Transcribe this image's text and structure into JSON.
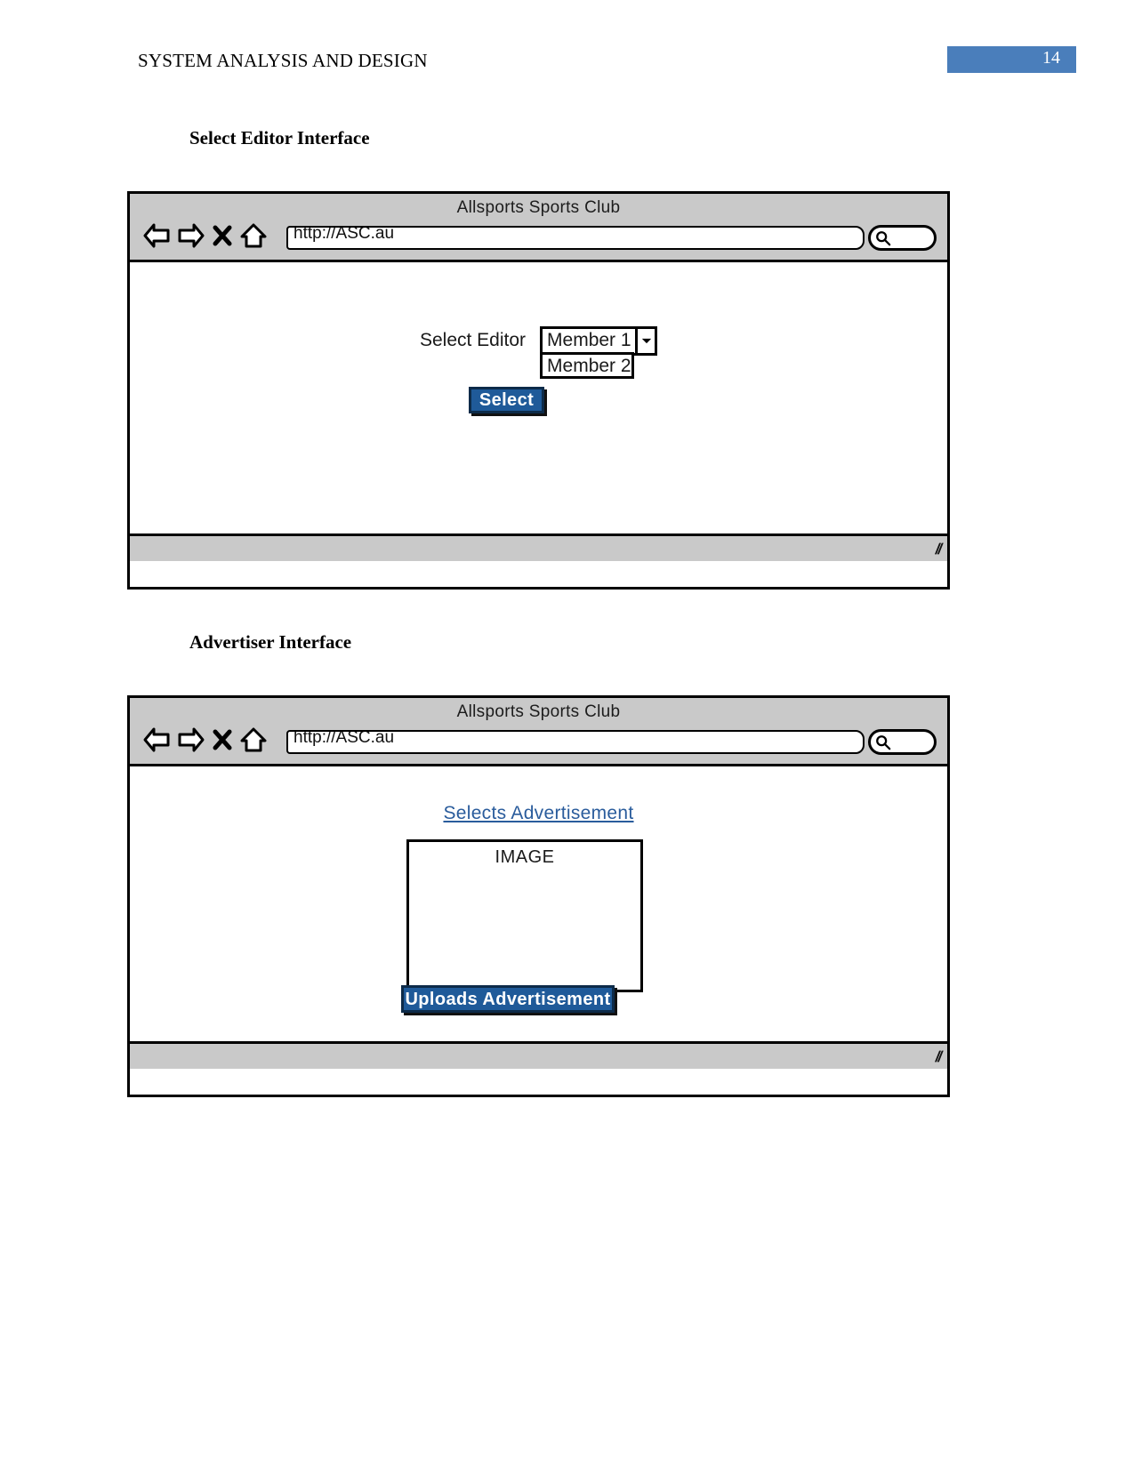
{
  "document": {
    "header_title": "SYSTEM ANALYSIS AND DESIGN",
    "page_number": "14",
    "page_number_color": "#4a7ebb"
  },
  "sections": [
    {
      "caption": "Select Editor Interface",
      "mockup": {
        "window_title": "Allsports Sports Club",
        "url_value": "http://ASC.au",
        "url_placeholder": "http://",
        "search_placeholder": "",
        "toolbar": {
          "back_label": "Back",
          "forward_label": "Forward",
          "stop_label": "Stop",
          "home_label": "Home",
          "search_label": "Search"
        },
        "resize_grip": "//",
        "form": {
          "label": "Select Editor",
          "selected_option": "Member 1",
          "options": [
            "Member 1",
            "Member 2"
          ],
          "open_option": "Member 2",
          "submit_label": "Select"
        }
      }
    },
    {
      "caption": "Advertiser Interface",
      "mockup": {
        "window_title": "Allsports Sports Club",
        "url_value": "http://ASC.au",
        "url_placeholder": "http://",
        "search_placeholder": "",
        "toolbar": {
          "back_label": "Back",
          "forward_label": "Forward",
          "stop_label": "Stop",
          "home_label": "Home",
          "search_label": "Search"
        },
        "resize_grip": "//",
        "content": {
          "link_label": "Selects Advertisement",
          "image_placeholder_label": "IMAGE",
          "upload_label": "Uploads Advertisement"
        }
      }
    }
  ],
  "colors": {
    "button_fill": "#1f5a99",
    "button_text": "#ffffff",
    "link": "#2a5c9c",
    "chrome": "#c9c9c9",
    "outline": "#000000"
  }
}
